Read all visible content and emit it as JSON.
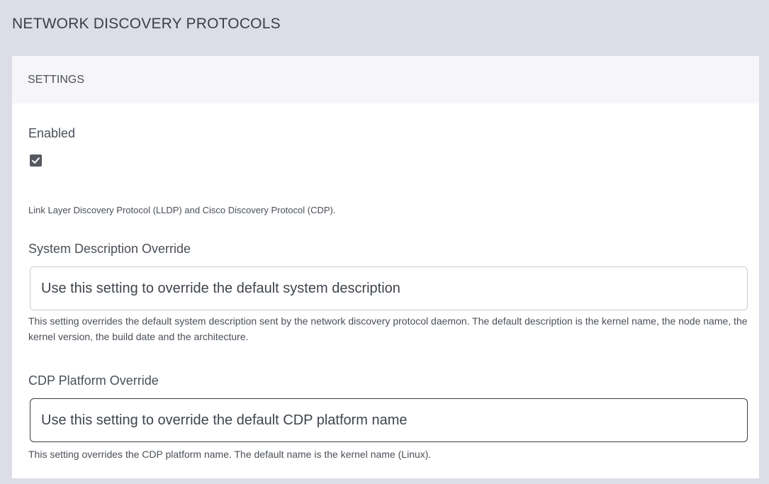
{
  "page": {
    "title": "NETWORK DISCOVERY PROTOCOLS"
  },
  "settings": {
    "header": "SETTINGS",
    "enabled": {
      "label": "Enabled",
      "checked": true
    },
    "protocols_help": "Link Layer Discovery Protocol (LLDP) and Cisco Discovery Protocol (CDP).",
    "system_description": {
      "label": "System Description Override",
      "placeholder": "Use this setting to override the default system description",
      "value": "",
      "help": "This setting overrides the default system description sent by the network discovery protocol daemon. The default description is the kernel name, the node name, the kernel version, the build date and the architecture."
    },
    "cdp_platform": {
      "label": "CDP Platform Override",
      "placeholder": "Use this setting to override the default CDP platform name",
      "value": "",
      "help": "This setting overrides the CDP platform name. The default name is the kernel name (Linux)."
    }
  },
  "colors": {
    "outer_background": "#dcdde7",
    "panel_background": "#ffffff",
    "panel_header_background": "#f6f6f8",
    "checkbox_fill": "#555a60",
    "focused_border": "#3a3f45"
  }
}
